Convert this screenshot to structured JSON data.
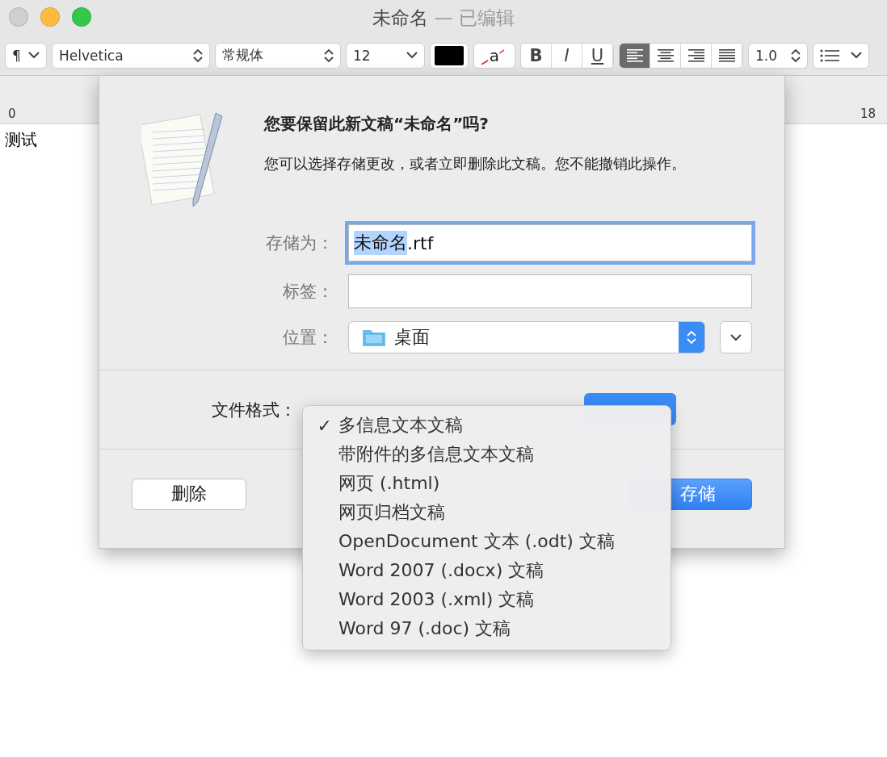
{
  "window": {
    "title": "未命名",
    "title_suffix": "— 已编辑"
  },
  "toolbar": {
    "paragraph": "¶",
    "font": "Helvetica",
    "style": "常规体",
    "size": "12",
    "highlight_glyph": "a",
    "bold": "B",
    "italic": "I",
    "underline": "U",
    "alignments": [
      {
        "selected": true
      },
      {
        "selected": false
      },
      {
        "selected": false
      },
      {
        "selected": false
      }
    ],
    "spacing": "1.0"
  },
  "ruler": {
    "start": "0",
    "end": "18"
  },
  "document": {
    "text": "测试"
  },
  "dialog": {
    "title": "您要保留此新文稿“未命名”吗?",
    "message": "您可以选择存储更改，或者立即删除此文稿。您不能撤销此操作。",
    "fields": [
      {
        "kind": "text",
        "label": "存储为：",
        "selected_text": "未命名",
        "rest_text": ".rtf",
        "focused": true
      },
      {
        "kind": "text",
        "label": "标签：",
        "focused": false
      },
      {
        "kind": "popup",
        "label": "位置：",
        "value": "桌面"
      }
    ],
    "format_label": "文件格式：",
    "delete_button": "删除",
    "save_button": "存储"
  },
  "format_menu": {
    "check": "✓",
    "items": [
      {
        "label": "多信息文本文稿",
        "selected": true
      },
      {
        "label": "带附件的多信息文本文稿",
        "selected": false
      },
      {
        "label": "网页 (.html)",
        "selected": false
      },
      {
        "label": "网页归档文稿",
        "selected": false
      },
      {
        "label": "OpenDocument 文本 (.odt) 文稿",
        "selected": false
      },
      {
        "label": "Word 2007 (.docx) 文稿",
        "selected": false
      },
      {
        "label": "Word 2003 (.xml) 文稿",
        "selected": false
      },
      {
        "label": "Word 97 (.doc) 文稿",
        "selected": false
      }
    ]
  }
}
